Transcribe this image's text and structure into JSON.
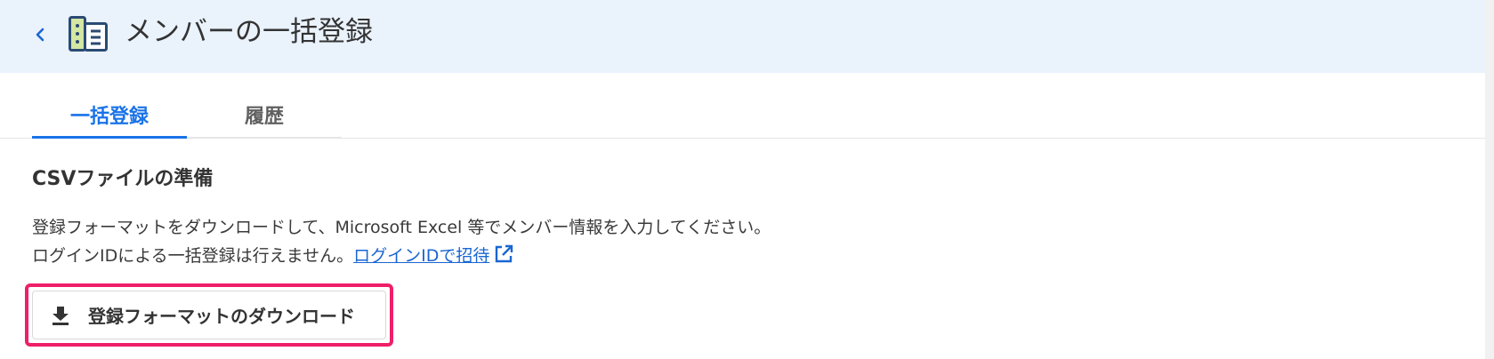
{
  "header": {
    "title": "メンバーの一括登録"
  },
  "tabs": [
    {
      "label": "一括登録",
      "active": true
    },
    {
      "label": "履歴",
      "active": false
    }
  ],
  "section": {
    "title": "CSVファイルの準備",
    "description_line1": "登録フォーマットをダウンロードして、Microsoft Excel 等でメンバー情報を入力してください。",
    "description_line2_prefix": "ログインIDによる一括登録は行えません。",
    "invite_link": "ログインIDで招待"
  },
  "download_button": {
    "label": "登録フォーマットのダウンロード"
  },
  "colors": {
    "header_bg": "#eaf2fc",
    "accent": "#1a73e8",
    "link": "#1a66d2",
    "highlight": "#ee1f68"
  },
  "icons": {
    "back": "chevron-left-icon",
    "app": "member-list-icon",
    "external": "external-link-icon",
    "download": "download-icon"
  }
}
